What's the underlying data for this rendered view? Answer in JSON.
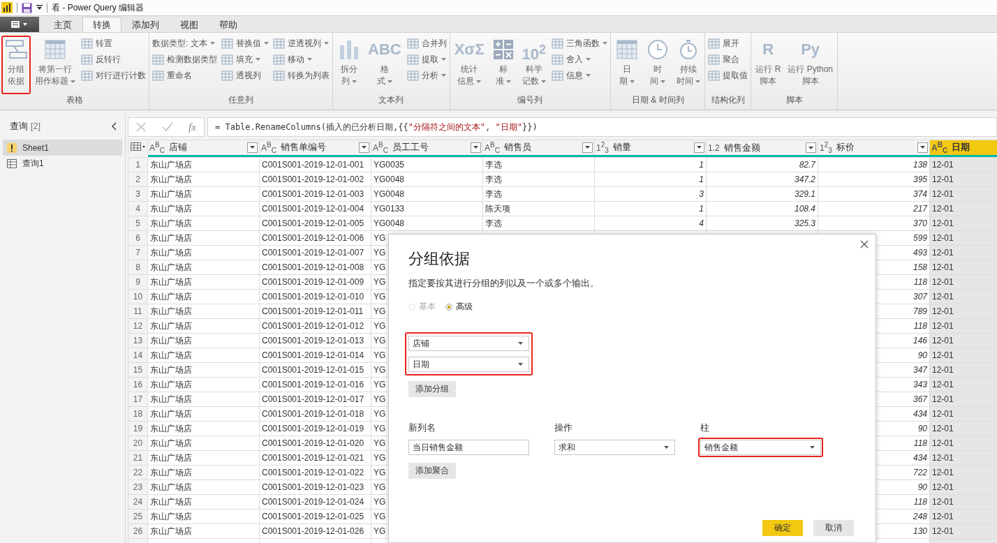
{
  "window": {
    "title": "看 - Power Query 编辑器"
  },
  "tabs": [
    {
      "label": "主页",
      "selected": false
    },
    {
      "label": "转换",
      "selected": true
    },
    {
      "label": "添加列",
      "selected": false
    },
    {
      "label": "视图",
      "selected": false
    },
    {
      "label": "帮助",
      "selected": false
    }
  ],
  "ribbon": [
    {
      "label": "表格",
      "columns": [
        {
          "kind": "large",
          "lines": [
            "分组",
            "依据"
          ],
          "dropdown": false,
          "highlighted": true
        },
        {
          "kind": "large",
          "lines": [
            "将第一行",
            "用作标题"
          ],
          "dropdown": true,
          "highlighted": false
        },
        {
          "kind": "stack",
          "items": [
            {
              "label": "转置",
              "dropdown": false
            },
            {
              "label": "反转行",
              "dropdown": false
            },
            {
              "label": "对行进行计数",
              "dropdown": false
            }
          ]
        }
      ]
    },
    {
      "label": "任意列",
      "columns": [
        {
          "kind": "stack",
          "items": [
            {
              "label": "数据类型: 文本",
              "dropdown": true,
              "plain": true
            },
            {
              "label": "检测数据类型",
              "dropdown": false
            },
            {
              "label": "重命名",
              "dropdown": false
            }
          ]
        },
        {
          "kind": "stack",
          "items": [
            {
              "label": "替换值",
              "dropdown": true
            },
            {
              "label": "填充",
              "dropdown": true
            },
            {
              "label": "透视列",
              "dropdown": false
            }
          ]
        },
        {
          "kind": "stack",
          "items": [
            {
              "label": "逆透视列",
              "dropdown": true
            },
            {
              "label": "移动",
              "dropdown": true
            },
            {
              "label": "转换为列表",
              "dropdown": false
            }
          ]
        }
      ]
    },
    {
      "label": "文本列",
      "columns": [
        {
          "kind": "large",
          "lines": [
            "拆分",
            "列"
          ],
          "dropdown": true,
          "highlighted": false
        },
        {
          "kind": "large",
          "lines": [
            "格",
            "式"
          ],
          "dropdown": true,
          "highlighted": false,
          "glyph": "ABC"
        },
        {
          "kind": "stack",
          "items": [
            {
              "label": "合并列",
              "dropdown": false
            },
            {
              "label": "提取",
              "dropdown": true
            },
            {
              "label": "分析",
              "dropdown": true
            }
          ]
        }
      ]
    },
    {
      "label": "编号列",
      "columns": [
        {
          "kind": "large",
          "lines": [
            "统计",
            "信息"
          ],
          "dropdown": true,
          "highlighted": false,
          "glyph": "XσΣ"
        },
        {
          "kind": "large",
          "lines": [
            "标",
            "准"
          ],
          "dropdown": true,
          "highlighted": false
        },
        {
          "kind": "large",
          "lines": [
            "科学",
            "记数"
          ],
          "dropdown": true,
          "highlighted": false,
          "glyph": "10$^{2}$"
        },
        {
          "kind": "stack",
          "items": [
            {
              "label": "三角函数",
              "dropdown": true
            },
            {
              "label": "舍入",
              "dropdown": true
            },
            {
              "label": "信息",
              "dropdown": true
            }
          ]
        }
      ]
    },
    {
      "label": "日期 & 时间列",
      "columns": [
        {
          "kind": "large",
          "lines": [
            "日",
            "期"
          ],
          "dropdown": true,
          "highlighted": false
        },
        {
          "kind": "large",
          "lines": [
            "时",
            "间"
          ],
          "dropdown": true,
          "highlighted": false
        },
        {
          "kind": "large",
          "lines": [
            "持续",
            "时间"
          ],
          "dropdown": true,
          "highlighted": false
        }
      ]
    },
    {
      "label": "结构化列",
      "columns": [
        {
          "kind": "stack",
          "items": [
            {
              "label": "展开",
              "dropdown": false
            },
            {
              "label": "聚合",
              "dropdown": false
            },
            {
              "label": "提取值",
              "dropdown": false
            }
          ]
        }
      ]
    },
    {
      "label": "脚本",
      "columns": [
        {
          "kind": "large",
          "lines": [
            "运行 R",
            "脚本"
          ],
          "dropdown": false,
          "highlighted": false,
          "glyph": "R"
        },
        {
          "kind": "large",
          "lines": [
            "运行 Python",
            "脚本"
          ],
          "dropdown": false,
          "highlighted": false,
          "glyph": "Py"
        }
      ]
    }
  ],
  "queries": {
    "title": "查询",
    "count": "[2]",
    "items": [
      {
        "label": "Sheet1",
        "selected": true,
        "warning": true
      },
      {
        "label": "查询1",
        "selected": false,
        "warning": false
      }
    ]
  },
  "formula_bar": {
    "fx": "fx",
    "segments": [
      {
        "kind": "code",
        "text": "= Table.RenameColumns(插入的已分析日期,{{"
      },
      {
        "kind": "string",
        "text": "\"分隔符之间的文本\""
      },
      {
        "kind": "code",
        "text": ", "
      },
      {
        "kind": "string",
        "text": "\"日期\""
      },
      {
        "kind": "code",
        "text": "}})"
      }
    ]
  },
  "table": {
    "columns": [
      {
        "name": "店铺",
        "type_label": "A$^{B}$$_{C}$",
        "kind": "text",
        "selected": false,
        "filter": true
      },
      {
        "name": "销售单编号",
        "type_label": "A$^{B}$$_{C}$",
        "kind": "text",
        "selected": false,
        "filter": true
      },
      {
        "name": "员工工号",
        "type_label": "A$^{B}$$_{C}$",
        "kind": "text",
        "selected": false,
        "filter": true
      },
      {
        "name": "销售员",
        "type_label": "A$^{B}$$_{C}$",
        "kind": "text",
        "selected": false,
        "filter": true
      },
      {
        "name": "销量",
        "type_label": "1$^{2}$$_{3}$",
        "kind": "number",
        "selected": false,
        "filter": true
      },
      {
        "name": "销售金额",
        "type_label": "1.2",
        "kind": "number",
        "selected": false,
        "filter": true
      },
      {
        "name": "标价",
        "type_label": "1$^{2}$$_{3}$",
        "kind": "number",
        "selected": false,
        "filter": true
      },
      {
        "name": "日期",
        "type_label": "A$^{B}$$_{C}$",
        "kind": "text",
        "selected": true,
        "filter": false
      }
    ],
    "rows": [
      {
        "n": "1",
        "cells": [
          "东山广场店",
          "C001S001-2019-12-01-001",
          "YG0035",
          "李选",
          "1",
          "82.7",
          "138",
          "12-01"
        ]
      },
      {
        "n": "2",
        "cells": [
          "东山广场店",
          "C001S001-2019-12-01-002",
          "YG0048",
          "李选",
          "1",
          "347.2",
          "395",
          "12-01"
        ]
      },
      {
        "n": "3",
        "cells": [
          "东山广场店",
          "C001S001-2019-12-01-003",
          "YG0048",
          "李选",
          "3",
          "329.1",
          "374",
          "12-01"
        ]
      },
      {
        "n": "4",
        "cells": [
          "东山广场店",
          "C001S001-2019-12-01-004",
          "YG0133",
          "陈天项",
          "1",
          "108.4",
          "217",
          "12-01"
        ]
      },
      {
        "n": "5",
        "cells": [
          "东山广场店",
          "C001S001-2019-12-01-005",
          "YG0048",
          "李选",
          "4",
          "325.3",
          "370",
          "12-01"
        ]
      },
      {
        "n": "6",
        "cells": [
          "东山广场店",
          "C001S001-2019-12-01-006",
          "YG",
          "",
          "",
          "",
          "599",
          "12-01"
        ]
      },
      {
        "n": "7",
        "cells": [
          "东山广场店",
          "C001S001-2019-12-01-007",
          "YG",
          "",
          "",
          "",
          "493",
          "12-01"
        ]
      },
      {
        "n": "8",
        "cells": [
          "东山广场店",
          "C001S001-2019-12-01-008",
          "YG",
          "",
          "",
          "",
          "158",
          "12-01"
        ]
      },
      {
        "n": "9",
        "cells": [
          "东山广场店",
          "C001S001-2019-12-01-009",
          "YG",
          "",
          "",
          "",
          "118",
          "12-01"
        ]
      },
      {
        "n": "10",
        "cells": [
          "东山广场店",
          "C001S001-2019-12-01-010",
          "YG",
          "",
          "",
          "",
          "307",
          "12-01"
        ]
      },
      {
        "n": "11",
        "cells": [
          "东山广场店",
          "C001S001-2019-12-01-011",
          "YG",
          "",
          "",
          "",
          "789",
          "12-01"
        ]
      },
      {
        "n": "12",
        "cells": [
          "东山广场店",
          "C001S001-2019-12-01-012",
          "YG",
          "",
          "",
          "",
          "118",
          "12-01"
        ]
      },
      {
        "n": "13",
        "cells": [
          "东山广场店",
          "C001S001-2019-12-01-013",
          "YG",
          "",
          "",
          "",
          "146",
          "12-01"
        ]
      },
      {
        "n": "14",
        "cells": [
          "东山广场店",
          "C001S001-2019-12-01-014",
          "YG",
          "",
          "",
          "",
          "90",
          "12-01"
        ]
      },
      {
        "n": "15",
        "cells": [
          "东山广场店",
          "C001S001-2019-12-01-015",
          "YG",
          "",
          "",
          "",
          "347",
          "12-01"
        ]
      },
      {
        "n": "16",
        "cells": [
          "东山广场店",
          "C001S001-2019-12-01-016",
          "YG",
          "",
          "",
          "",
          "343",
          "12-01"
        ]
      },
      {
        "n": "17",
        "cells": [
          "东山广场店",
          "C001S001-2019-12-01-017",
          "YG",
          "",
          "",
          "",
          "367",
          "12-01"
        ]
      },
      {
        "n": "18",
        "cells": [
          "东山广场店",
          "C001S001-2019-12-01-018",
          "YG",
          "",
          "",
          "",
          "434",
          "12-01"
        ]
      },
      {
        "n": "19",
        "cells": [
          "东山广场店",
          "C001S001-2019-12-01-019",
          "YG",
          "",
          "",
          "",
          "90",
          "12-01"
        ]
      },
      {
        "n": "20",
        "cells": [
          "东山广场店",
          "C001S001-2019-12-01-020",
          "YG",
          "",
          "",
          "",
          "118",
          "12-01"
        ]
      },
      {
        "n": "21",
        "cells": [
          "东山广场店",
          "C001S001-2019-12-01-021",
          "YG",
          "",
          "",
          "",
          "434",
          "12-01"
        ]
      },
      {
        "n": "22",
        "cells": [
          "东山广场店",
          "C001S001-2019-12-01-022",
          "YG",
          "",
          "",
          "",
          "722",
          "12-01"
        ]
      },
      {
        "n": "23",
        "cells": [
          "东山广场店",
          "C001S001-2019-12-01-023",
          "YG",
          "",
          "",
          "",
          "90",
          "12-01"
        ]
      },
      {
        "n": "24",
        "cells": [
          "东山广场店",
          "C001S001-2019-12-01-024",
          "YG",
          "",
          "",
          "",
          "118",
          "12-01"
        ]
      },
      {
        "n": "25",
        "cells": [
          "东山广场店",
          "C001S001-2019-12-01-025",
          "YG",
          "",
          "",
          "",
          "248",
          "12-01"
        ]
      },
      {
        "n": "26",
        "cells": [
          "东山广场店",
          "C001S001-2019-12-01-026",
          "YG",
          "",
          "",
          "",
          "130",
          "12-01"
        ]
      }
    ]
  },
  "dialog": {
    "title": "分组依据",
    "description": "指定要按其进行分组的列以及一个或多个输出。",
    "modes": [
      {
        "label": "基本",
        "selected": false,
        "disabled": true
      },
      {
        "label": "高级",
        "selected": true,
        "disabled": false
      }
    ],
    "group_by": {
      "highlighted": true,
      "fields": [
        "店铺",
        "日期"
      ]
    },
    "add_group_button": "添加分组",
    "aggregation_fields": [
      {
        "label": "新列名",
        "value": "当日销售金额",
        "kind": "input",
        "highlighted": false
      },
      {
        "label": "操作",
        "value": "求和",
        "kind": "select",
        "highlighted": false
      },
      {
        "label": "柱",
        "value": "销售金额",
        "kind": "select",
        "highlighted": true
      }
    ],
    "add_aggregation_button": "添加聚合",
    "buttons": [
      {
        "label": "确定",
        "primary": true
      },
      {
        "label": "取消",
        "primary": false
      }
    ]
  }
}
